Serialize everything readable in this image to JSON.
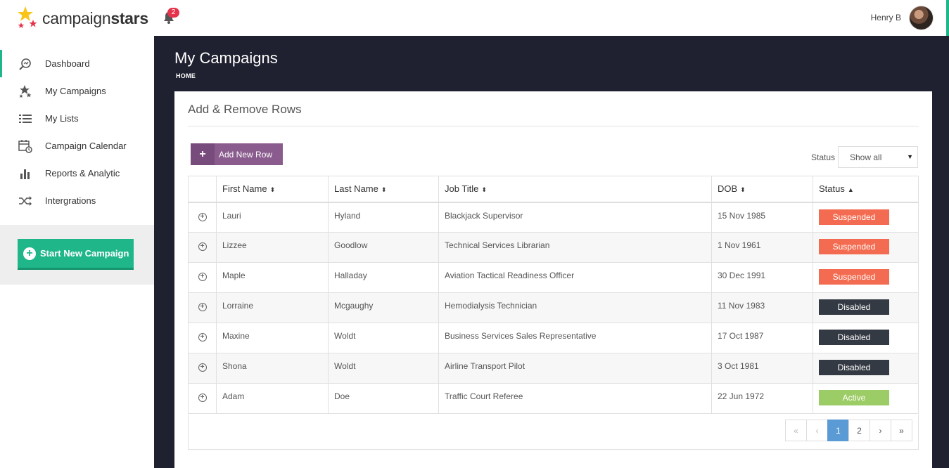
{
  "header": {
    "logo_prefix": "campaign",
    "logo_suffix": "stars",
    "notification_count": "2",
    "user_name": "Henry B"
  },
  "sidebar": {
    "items": [
      {
        "label": "Dashboard",
        "icon": "search-chart-icon",
        "active": true
      },
      {
        "label": "My Campaigns",
        "icon": "stars-icon",
        "active": false
      },
      {
        "label": "My Lists",
        "icon": "list-icon",
        "active": false
      },
      {
        "label": "Campaign Calendar",
        "icon": "calendar-icon",
        "active": false
      },
      {
        "label": "Reports & Analytic",
        "icon": "bar-chart-icon",
        "active": false
      },
      {
        "label": "Intergrations",
        "icon": "shuffle-icon",
        "active": false
      }
    ],
    "cta_label": "Start New Campaign"
  },
  "page": {
    "title": "My Campaigns",
    "breadcrumb": "HOME"
  },
  "panel": {
    "title": "Add & Remove Rows",
    "add_button": "Add New Row",
    "status_label": "Status",
    "status_value": "Show all"
  },
  "table": {
    "columns": [
      "First Name",
      "Last Name",
      "Job Title",
      "DOB",
      "Status"
    ],
    "rows": [
      {
        "first": "Lauri",
        "last": "Hyland",
        "job": "Blackjack Supervisor",
        "dob": "15 Nov 1985",
        "status": "Suspended"
      },
      {
        "first": "Lizzee",
        "last": "Goodlow",
        "job": "Technical Services Librarian",
        "dob": "1 Nov 1961",
        "status": "Suspended"
      },
      {
        "first": "Maple",
        "last": "Halladay",
        "job": "Aviation Tactical Readiness Officer",
        "dob": "30 Dec 1991",
        "status": "Suspended"
      },
      {
        "first": "Lorraine",
        "last": "Mcgaughy",
        "job": "Hemodialysis Technician",
        "dob": "11 Nov 1983",
        "status": "Disabled"
      },
      {
        "first": "Maxine",
        "last": "Woldt",
        "job": "Business Services Sales Representative",
        "dob": "17 Oct 1987",
        "status": "Disabled"
      },
      {
        "first": "Shona",
        "last": "Woldt",
        "job": "Airline Transport Pilot",
        "dob": "3 Oct 1981",
        "status": "Disabled"
      },
      {
        "first": "Adam",
        "last": "Doe",
        "job": "Traffic Court Referee",
        "dob": "22 Jun 1972",
        "status": "Active"
      }
    ]
  },
  "pagination": {
    "first": "«",
    "prev": "‹",
    "pages": [
      "1",
      "2"
    ],
    "current": "1",
    "next": "›",
    "last": "»"
  },
  "colors": {
    "accent": "#1fb68a",
    "suspended": "#f36c51",
    "disabled": "#343a43",
    "active": "#9ccc65",
    "add_button": "#8a5c8e",
    "page_current": "#5b9bd5"
  }
}
